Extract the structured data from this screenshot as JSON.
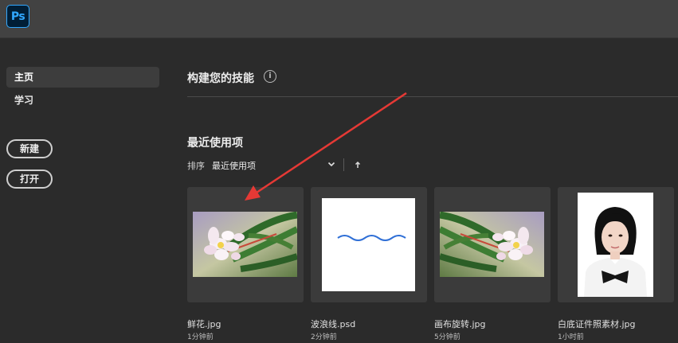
{
  "app": {
    "logo": "Ps"
  },
  "sidebar": {
    "items": [
      {
        "label": "主页",
        "active": true
      },
      {
        "label": "学习",
        "active": false
      }
    ],
    "new_button": "新建",
    "open_button": "打开"
  },
  "main": {
    "skills_title": "构建您的技能",
    "info_symbol": "i",
    "recent_title": "最近使用项",
    "sort_label": "排序",
    "sort_value": "最近使用项"
  },
  "recent_files": [
    {
      "name": "鲜花.jpg",
      "time": "1分钟前"
    },
    {
      "name": "波浪线.psd",
      "time": "2分钟前"
    },
    {
      "name": "画布旋转.jpg",
      "time": "5分钟前"
    },
    {
      "name": "白底证件照素材.jpg",
      "time": "1小时前"
    }
  ],
  "colors": {
    "accent_ps": "#31a8ff",
    "annotation_arrow": "#e53935",
    "wave_line": "#2f6fd6"
  },
  "icons": [
    "ps-logo-icon",
    "info-icon",
    "chevron-down-icon",
    "sort-ascending-icon",
    "annotation-arrow-icon"
  ]
}
